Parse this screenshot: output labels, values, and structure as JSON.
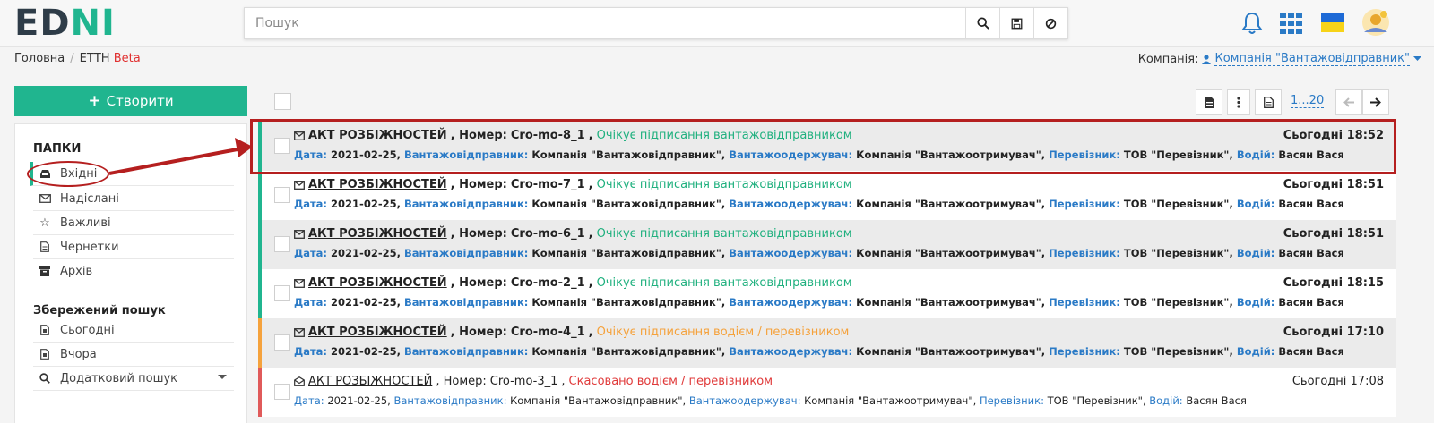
{
  "header": {
    "logo_left": "ED",
    "logo_right": "NI",
    "search_placeholder": "Пошук",
    "icons": [
      "search-icon",
      "save-icon",
      "ban-icon",
      "bell-icon",
      "apps-grid-icon",
      "ukraine-flag-icon",
      "user-avatar-icon"
    ]
  },
  "breadcrumb": {
    "home": "Головна",
    "separator": "/",
    "section": "ЕТТН",
    "badge": "Beta"
  },
  "company": {
    "label": "Компанія:",
    "value": "Компанія \"Вантажовідправник\""
  },
  "sidebar": {
    "create_label": "Створити",
    "create_icon": "+",
    "folders_heading": "ПАПКИ",
    "folders": [
      {
        "label": "Вхідні",
        "icon": "inbox-icon",
        "active": true
      },
      {
        "label": "Надіслані",
        "icon": "envelope-icon"
      },
      {
        "label": "Важливі",
        "icon": "star-icon"
      },
      {
        "label": "Чернетки",
        "icon": "file-icon"
      },
      {
        "label": "Архів",
        "icon": "archive-icon"
      }
    ],
    "saved_heading": "Збережений пошук",
    "saved": [
      {
        "label": "Сьогодні",
        "icon": "doc-icon"
      },
      {
        "label": "Вчора",
        "icon": "doc-icon"
      },
      {
        "label": "Додатковий пошук",
        "icon": "search-icon"
      }
    ]
  },
  "toolbar": {
    "pager": "1...20",
    "icons": [
      "export-icon",
      "more-icon",
      "report-icon",
      "prev-arrow-icon",
      "next-arrow-icon"
    ]
  },
  "labels": {
    "date": "Дата:",
    "shipper": "Вантажовідправник:",
    "consignee": "Вантажоодержувач:",
    "carrier": "Перевізник:",
    "driver": "Водій:",
    "number": ", Номер:"
  },
  "colors": {
    "accent": "#20b58f",
    "link": "#2a7ac6",
    "status_green": "#1fb07e",
    "status_orange": "#f5a23c",
    "status_red": "#e03a3a",
    "annotation": "#b51f1f"
  },
  "documents": [
    {
      "type": "АКТ РОЗБІЖНОСТЕЙ",
      "number": "Cro-mo-8_1",
      "status": "Очікує підписання вантажовідправником",
      "status_color": "green",
      "date": "2021-02-25",
      "shipper": "Компанія \"Вантажовідправник\"",
      "consignee": "Компанія \"Вантажоотримувач\"",
      "carrier": "ТОВ \"Перевізник\"",
      "driver": "Васян Вася",
      "time": "Сьогодні 18:52"
    },
    {
      "type": "АКТ РОЗБІЖНОСТЕЙ",
      "number": "Cro-mo-7_1",
      "status": "Очікує підписання вантажовідправником",
      "status_color": "green",
      "date": "2021-02-25",
      "shipper": "Компанія \"Вантажовідправник\"",
      "consignee": "Компанія \"Вантажоотримувач\"",
      "carrier": "ТОВ \"Перевізник\"",
      "driver": "Васян Вася",
      "time": "Сьогодні 18:51"
    },
    {
      "type": "АКТ РОЗБІЖНОСТЕЙ",
      "number": "Cro-mo-6_1",
      "status": "Очікує підписання вантажовідправником",
      "status_color": "green",
      "date": "2021-02-25",
      "shipper": "Компанія \"Вантажовідправник\"",
      "consignee": "Компанія \"Вантажоотримувач\"",
      "carrier": "ТОВ \"Перевізник\"",
      "driver": "Васян Вася",
      "time": "Сьогодні 18:51"
    },
    {
      "type": "АКТ РОЗБІЖНОСТЕЙ",
      "number": "Cro-mo-2_1",
      "status": "Очікує підписання вантажовідправником",
      "status_color": "green",
      "date": "2021-02-25",
      "shipper": "Компанія \"Вантажовідправник\"",
      "consignee": "Компанія \"Вантажоотримувач\"",
      "carrier": "ТОВ \"Перевізник\"",
      "driver": "Васян Вася",
      "time": "Сьогодні 18:15"
    },
    {
      "type": "АКТ РОЗБІЖНОСТЕЙ",
      "number": "Cro-mo-4_1",
      "status": "Очікує підписання водієм / перевізником",
      "status_color": "orange",
      "date": "2021-02-25",
      "shipper": "Компанія \"Вантажовідправник\"",
      "consignee": "Компанія \"Вантажоотримувач\"",
      "carrier": "ТОВ \"Перевізник\"",
      "driver": "Васян Вася",
      "time": "Сьогодні 17:10"
    },
    {
      "type": "АКТ РОЗБІЖНОСТЕЙ",
      "number": "Cro-mo-3_1",
      "status": "Скасовано водієм / перевізником",
      "status_color": "red",
      "date": "2021-02-25",
      "shipper": "Компанія \"Вантажовідправник\"",
      "consignee": "Компанія \"Вантажоотримувач\"",
      "carrier": "ТОВ \"Перевізник\"",
      "driver": "Васян Вася",
      "time": "Сьогодні 17:08"
    }
  ]
}
